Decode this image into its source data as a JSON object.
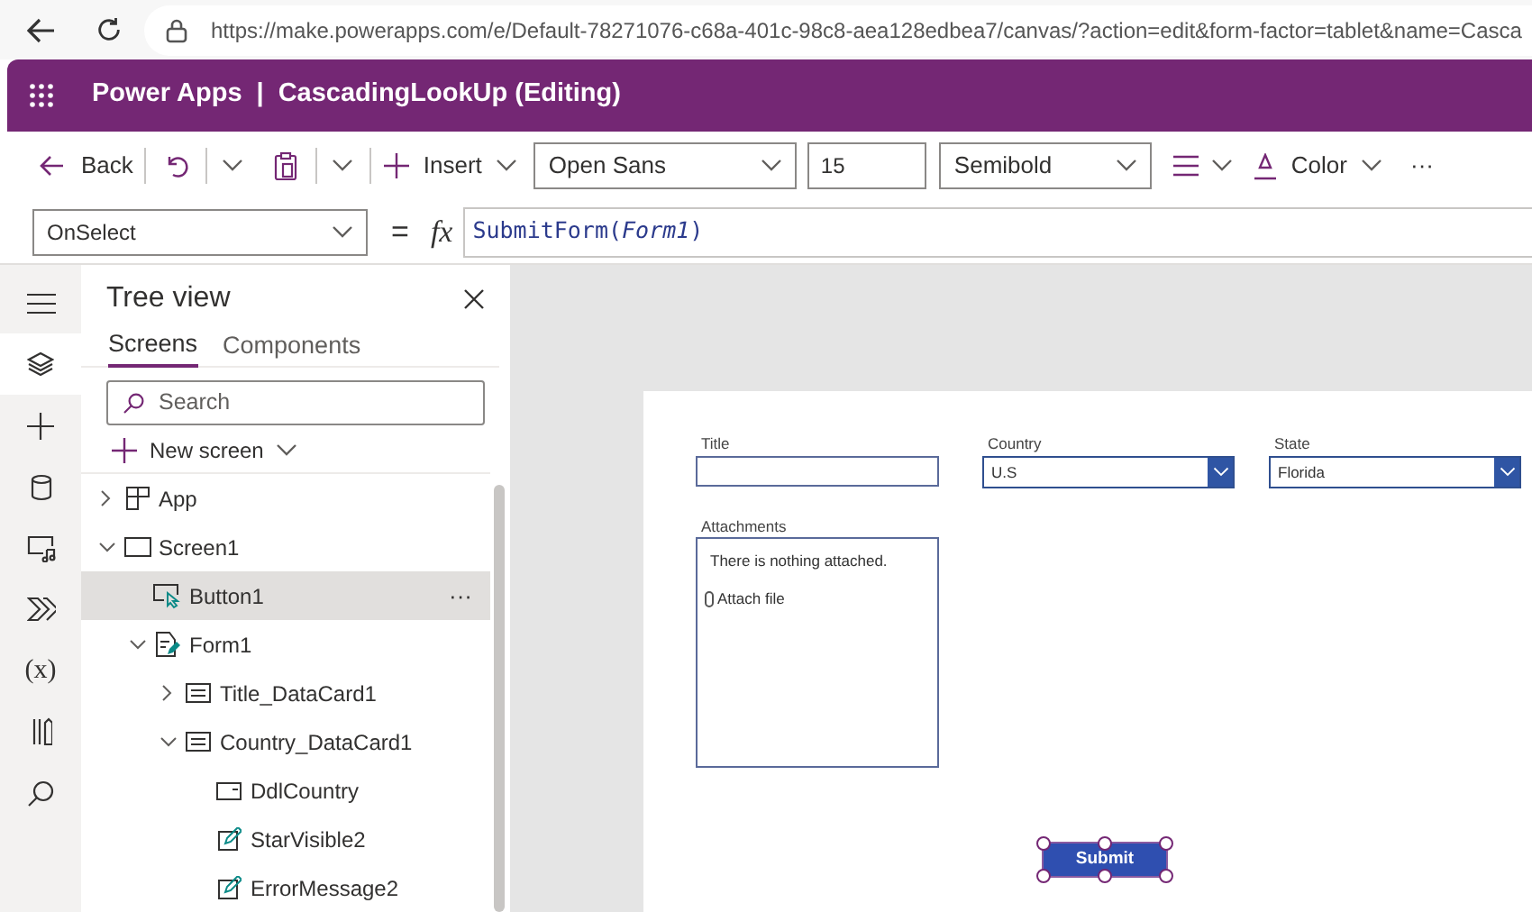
{
  "browser": {
    "url": "https://make.powerapps.com/e/Default-78271076-c68a-401c-98c8-aea128edbea7/canvas/?action=edit&form-factor=tablet&name=Casca"
  },
  "header": {
    "app": "Power Apps",
    "separator": "|",
    "title": "CascadingLookUp (Editing)"
  },
  "toolbar": {
    "back": "Back",
    "insert": "Insert",
    "font": "Open Sans",
    "size": "15",
    "weight": "Semibold",
    "color_label": "Color",
    "more": "···"
  },
  "formula_bar": {
    "property": "OnSelect",
    "equals": "=",
    "fx": "fx",
    "formula": "SubmitForm(*Form1*)"
  },
  "rail": [
    {
      "kind": "menu",
      "selected": false
    },
    {
      "kind": "layers",
      "selected": true
    },
    {
      "kind": "insert",
      "selected": false
    },
    {
      "kind": "data",
      "selected": false
    },
    {
      "kind": "media",
      "selected": false
    },
    {
      "kind": "flow",
      "selected": false
    },
    {
      "kind": "variables",
      "label": "(x)",
      "selected": false
    },
    {
      "kind": "tools",
      "selected": false
    },
    {
      "kind": "search",
      "selected": false
    }
  ],
  "tree_view": {
    "title": "Tree view",
    "tabs": [
      {
        "label": "Screens",
        "selected": true
      },
      {
        "label": "Components",
        "selected": false
      }
    ],
    "search": {
      "placeholder": "Search"
    },
    "new_screen": "New screen",
    "items": [
      {
        "label": "App",
        "kind": "app",
        "expanded": false,
        "selected": false
      },
      {
        "label": "Screen1",
        "kind": "screen",
        "expanded": true,
        "selected": false,
        "children": [
          {
            "label": "Button1",
            "kind": "button",
            "selected": true,
            "more": "···"
          },
          {
            "label": "Form1",
            "kind": "form",
            "expanded": true,
            "selected": false,
            "children": [
              {
                "label": "Title_DataCard1",
                "kind": "card",
                "expanded": false,
                "selected": false
              },
              {
                "label": "Country_DataCard1",
                "kind": "card",
                "expanded": true,
                "selected": false,
                "children": [
                  {
                    "label": "DdlCountry",
                    "kind": "dropdown",
                    "selected": false
                  },
                  {
                    "label": "StarVisible2",
                    "kind": "edit",
                    "selected": false
                  },
                  {
                    "label": "ErrorMessage2",
                    "kind": "edit",
                    "selected": false
                  }
                ]
              }
            ]
          }
        ]
      }
    ]
  },
  "canvas": {
    "fields": [
      {
        "label": "Title",
        "kind": "text"
      },
      {
        "label": "Country",
        "kind": "dropdown",
        "value": "U.S"
      },
      {
        "label": "State",
        "kind": "dropdown",
        "value": "Florida"
      }
    ],
    "attachments": {
      "label": "Attachments",
      "empty_text": "There is nothing attached.",
      "attach": "Attach file"
    },
    "submit": {
      "label": "Submit",
      "selected": true
    }
  }
}
